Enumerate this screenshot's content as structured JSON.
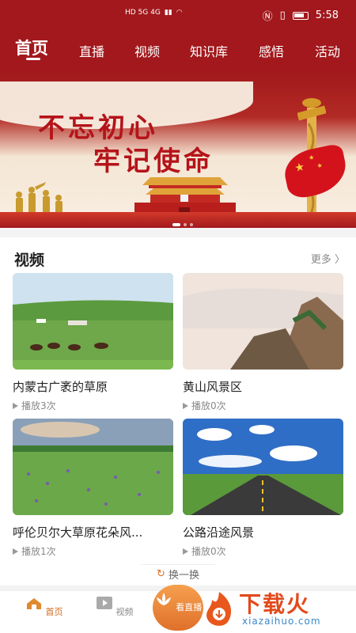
{
  "status_bar": {
    "network": "HD 5G 4G",
    "time": "5:58"
  },
  "top_nav": {
    "tabs": [
      {
        "label": "首页",
        "active": true
      },
      {
        "label": "直播"
      },
      {
        "label": "视频"
      },
      {
        "label": "知识库"
      },
      {
        "label": "感悟"
      },
      {
        "label": "活动"
      }
    ]
  },
  "banner": {
    "line1": "不忘初心",
    "line2": "牢记使命"
  },
  "videos": {
    "title": "视频",
    "more": "更多 〉",
    "items": [
      {
        "title": "内蒙古广袤的草原",
        "plays": "播放3次"
      },
      {
        "title": "黄山风景区",
        "plays": "播放0次"
      },
      {
        "title": "呼伦贝尔大草原花朵风...",
        "plays": "播放1次"
      },
      {
        "title": "公路沿途风景",
        "plays": "播放0次"
      }
    ],
    "refresh": "换一换"
  },
  "bottom_nav": {
    "home": "首页",
    "video": "视频",
    "live": "看直播"
  },
  "watermark": {
    "text": "下载火",
    "sub": "xiazaihuo.com"
  },
  "colors": {
    "brand_red": "#a2181c",
    "accent_orange": "#e0702a"
  }
}
